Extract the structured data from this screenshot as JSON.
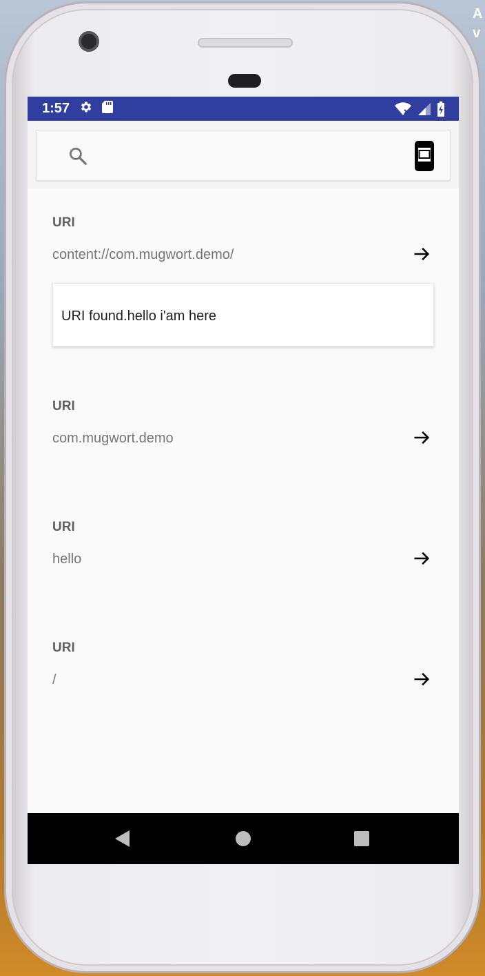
{
  "desktop": {
    "edge_text": [
      "A",
      "v"
    ]
  },
  "status_bar": {
    "time": "1:57",
    "background": "#303f9f",
    "icons_left": [
      "gear-icon",
      "sd-card-icon"
    ],
    "icons_right": [
      "wifi-off-icon",
      "signal-icon",
      "battery-charging-icon"
    ]
  },
  "search": {
    "placeholder": "",
    "icon": "search-icon",
    "device_icon": "phone-device-icon"
  },
  "entries": [
    {
      "label": "URI",
      "value": "content://com.mugwort.demo/"
    },
    {
      "label": "URI",
      "value": "com.mugwort.demo"
    },
    {
      "label": "URI",
      "value": "hello"
    },
    {
      "label": "URI",
      "value": "/"
    }
  ],
  "result": {
    "text": "URI found.hello i'am here"
  },
  "nav_bar": {
    "icons": [
      "back-icon",
      "home-icon",
      "recents-icon"
    ]
  }
}
